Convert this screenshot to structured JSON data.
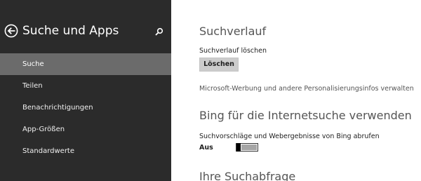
{
  "nav": {
    "title": "Suche und Apps",
    "back_icon": "back-arrow-circle-icon",
    "search_icon": "search-icon",
    "items": [
      {
        "label": "Suche",
        "active": true
      },
      {
        "label": "Teilen",
        "active": false
      },
      {
        "label": "Benachrichtigungen",
        "active": false
      },
      {
        "label": "App-Größen",
        "active": false
      },
      {
        "label": "Standardwerte",
        "active": false
      }
    ]
  },
  "content": {
    "history": {
      "heading": "Suchverlauf",
      "clear_label": "Suchverlauf löschen",
      "clear_button": "Löschen",
      "ads_link": "Microsoft-Werbung und andere Personalisierungsinfos verwalten"
    },
    "bing": {
      "heading": "Bing für die Internetsuche verwenden",
      "suggestions_label": "Suchvorschläge und Webergebnisse von Bing abrufen",
      "toggle_state": "Aus",
      "toggle_on": false
    },
    "queries": {
      "heading": "Ihre Suchabfrage"
    }
  },
  "colors": {
    "nav_background": "#2b2b2b",
    "nav_active": "#6b6b6b",
    "heading_gray": "#555555",
    "button_gray": "#cccccc"
  }
}
